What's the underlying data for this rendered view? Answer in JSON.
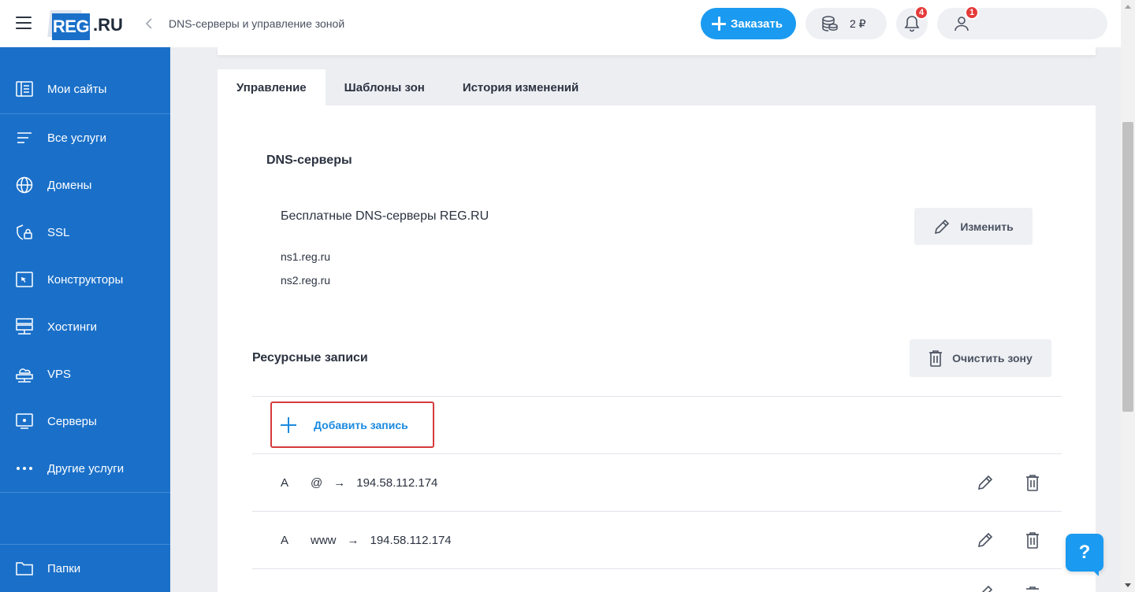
{
  "header": {
    "breadcrumb": "DNS-серверы и управление зоной",
    "logo_main": "REG",
    "logo_suffix": ".RU",
    "order_label": "Заказать",
    "balance": "2 ₽",
    "notifications_count": "4",
    "account_count": "1"
  },
  "sidebar": {
    "items": [
      {
        "label": "Мои сайты",
        "icon": "sites-icon"
      },
      {
        "label": "Все услуги",
        "icon": "list-icon"
      },
      {
        "label": "Домены",
        "icon": "globe-icon"
      },
      {
        "label": "SSL",
        "icon": "shield-lock-icon"
      },
      {
        "label": "Конструкторы",
        "icon": "constructor-icon"
      },
      {
        "label": "Хостинги",
        "icon": "hosting-icon"
      },
      {
        "label": "VPS",
        "icon": "vps-cloud-icon"
      },
      {
        "label": "Серверы",
        "icon": "server-icon"
      },
      {
        "label": "Другие услуги",
        "icon": "more-dots-icon"
      }
    ],
    "folders_label": "Папки"
  },
  "tabs": [
    {
      "label": "Управление",
      "active": true
    },
    {
      "label": "Шаблоны зон",
      "active": false
    },
    {
      "label": "История изменений",
      "active": false
    }
  ],
  "dns": {
    "heading": "DNS-серверы",
    "name": "Бесплатные DNS-серверы REG.RU",
    "servers": [
      "ns1.reg.ru",
      "ns2.reg.ru"
    ],
    "change_label": "Изменить"
  },
  "records": {
    "heading": "Ресурсные записи",
    "clear_label": "Очистить зону",
    "add_label": "Добавить запись",
    "rows": [
      {
        "type": "A",
        "host": "@",
        "arrow": "→",
        "value": "194.58.112.174"
      },
      {
        "type": "A",
        "host": "www",
        "arrow": "→",
        "value": "194.58.112.174"
      }
    ]
  },
  "help_label": "?",
  "colors": {
    "brand": "#1a70c9",
    "accent": "#1a9af0",
    "highlight": "#d63b3b",
    "badge": "#e53a3a"
  }
}
